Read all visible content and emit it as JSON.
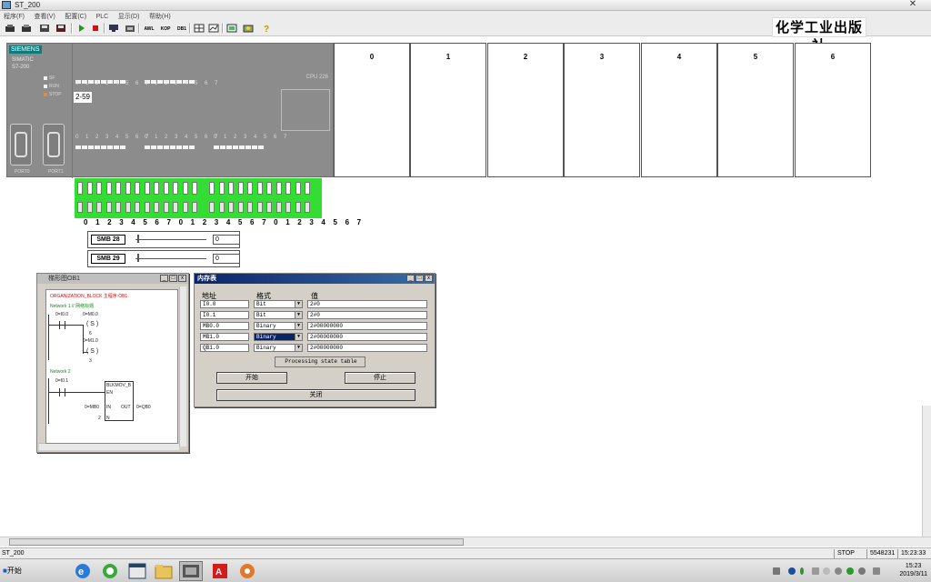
{
  "window": {
    "title": "ST_200"
  },
  "menu": [
    "程序(F)",
    "查看(V)",
    "配置(C)",
    "PLC",
    "显示(D)",
    "帮助(H)"
  ],
  "toolbar": {
    "awl": "AWL",
    "kop": "KOP",
    "db1": "DB1"
  },
  "publisher": "化学工业出版社",
  "plc": {
    "brand": "SIEMENS",
    "line1": "SIMATIC",
    "line2": "S7-200",
    "leds": [
      "SF",
      "RUN",
      "STOP"
    ],
    "led_colors": {
      "sf": "#f4f4f4",
      "run": "#f4f4f4",
      "stop": "#e08a3a"
    },
    "input_digits_a": "0 1 2 3 4 5 6 7",
    "input_digits_b": "0 1 2 3 4 5 6 7",
    "output_digits_a": "0 1 2 3 4 5 6 7",
    "output_digits_b": "0 1 2 3 4 5 6 7",
    "output_digits_c": "0 1 2 3 4 5 6 7",
    "cpu": "CPU 226",
    "counter": "2-59",
    "ports": [
      "PORT0",
      "PORT1"
    ]
  },
  "slots": [
    "0",
    "1",
    "2",
    "3",
    "4",
    "5",
    "6"
  ],
  "switch_labels": "0 1 2 3 4 5 6 7 0 1 2 3 4   5 6 7 0 1 2 3 4 5 6 7",
  "switch_color": "#33dd33",
  "smb": [
    {
      "label": "SMB 28",
      "value": "0"
    },
    {
      "label": "SMB 29",
      "value": "0"
    }
  ],
  "ladder_window": {
    "title": "梯形图OB1",
    "block_title": "ORGANIZATION_BLOCK 主程序:OB1",
    "network1": "Network 1 // 网络标题",
    "n1_contact": "0=I0.0",
    "n1_coil1_addr": "0=M0.0",
    "n1_coil1": "S",
    "n1_coil1_n": "6",
    "n1_coil2_addr": "0=M1.0",
    "n1_coil2": "S",
    "n1_coil2_n": "3",
    "network2": "Network 2",
    "n2_contact": "0=I0.1",
    "box_title": "BLKMOV_B",
    "box_en": "EN",
    "box_in": "IN",
    "box_out": "OUT",
    "box_n": "N",
    "in_addr": "0=MB0",
    "out_addr": "0=QB0",
    "n_value": "2"
  },
  "status_table": {
    "title": "内存表",
    "headers": {
      "address": "地址",
      "format": "格式",
      "value": "值"
    },
    "rows": [
      {
        "address": "I0.0",
        "format": "Bit",
        "value": "2#0"
      },
      {
        "address": "I0.1",
        "format": "Bit",
        "value": "2#0"
      },
      {
        "address": "MB0.0",
        "format": "Binary",
        "value": "2#00000000"
      },
      {
        "address": "MB1.0",
        "format": "Binary",
        "value": "2#00000000"
      },
      {
        "address": "QB1.0",
        "format": "Binary",
        "value": "2#00000000"
      }
    ],
    "processing": "Processing state table",
    "start": "开始",
    "stop": "停止",
    "close": "关闭"
  },
  "statusbar": {
    "left": "ST_200",
    "state": "STOP",
    "code": "5548231",
    "time": "15:23:33"
  },
  "taskbar": {
    "start": "开始",
    "clock_time": "15:23",
    "clock_date": "2019/3/11"
  }
}
